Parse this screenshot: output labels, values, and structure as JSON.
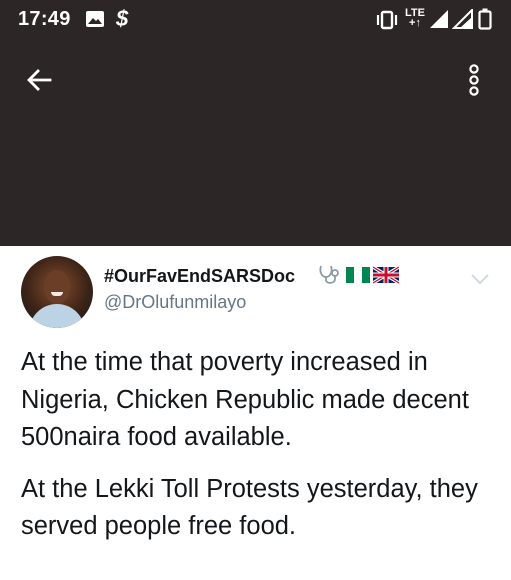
{
  "status_bar": {
    "time": "17:49",
    "network": "LTE",
    "icons": [
      "gallery-icon",
      "dollar-icon",
      "vibrate-icon",
      "lte-icon",
      "signal-icon",
      "signal-icon",
      "battery-icon"
    ]
  },
  "toolbar": {
    "back_icon": "arrow-left-icon",
    "more_icon": "more-vertical-icon"
  },
  "tweet": {
    "display_name": "#OurFavEndSARSDoc",
    "badges": [
      "stethoscope-icon",
      "nigeria-flag-icon",
      "uk-flag-icon"
    ],
    "handle": "@DrOlufunmilayo",
    "paragraphs": [
      "At the time that poverty increased in Nigeria, Chicken Republic made decent 500naira food available.",
      "At the Lekki Toll Protests yesterday, they served people free food."
    ]
  },
  "colors": {
    "header_bg": "#2c2626",
    "text": "#14171a",
    "secondary_text": "#657786",
    "nigeria_green": "#008751"
  }
}
